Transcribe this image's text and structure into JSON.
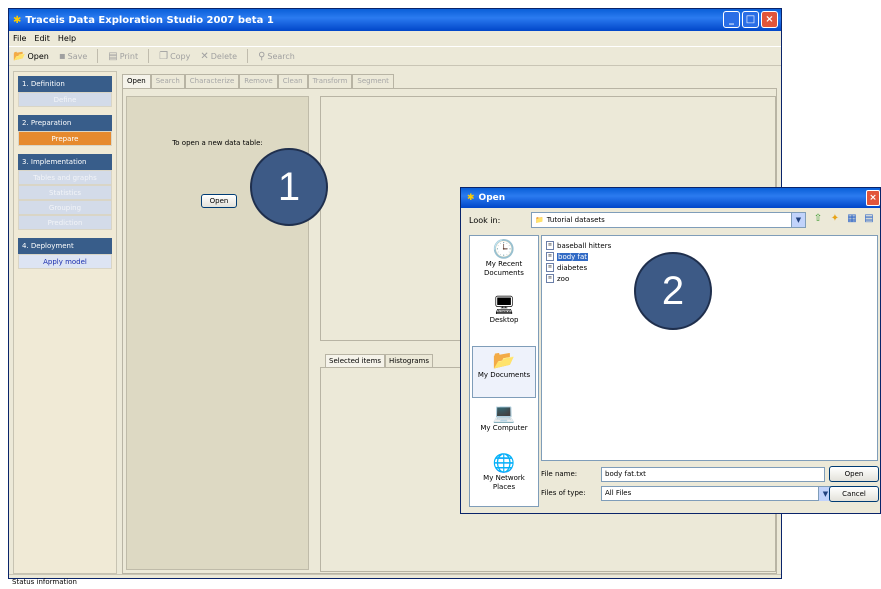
{
  "window": {
    "title": "Traceis Data Exploration Studio 2007 beta 1"
  },
  "menu": [
    "File",
    "Edit",
    "Help"
  ],
  "toolbar": {
    "open": "Open",
    "save": "Save",
    "print": "Print",
    "copy": "Copy",
    "delete": "Delete",
    "search": "Search"
  },
  "sidebar": {
    "s1": {
      "head": "1. Definition",
      "items": [
        "Define"
      ]
    },
    "s2": {
      "head": "2. Preparation",
      "items": [
        "Prepare"
      ]
    },
    "s3": {
      "head": "3. Implementation",
      "items": [
        "Tables and graphs",
        "Statistics",
        "Grouping",
        "Prediction"
      ]
    },
    "s4": {
      "head": "4. Deployment",
      "items": [
        "Apply model"
      ]
    }
  },
  "tabs": [
    "Open",
    "Search",
    "Characterize",
    "Remove",
    "Clean",
    "Transform",
    "Segment"
  ],
  "open_panel": {
    "prompt": "To open a new data table:",
    "button": "Open"
  },
  "view_tabs": [
    "Selected items",
    "Histograms"
  ],
  "status": "Status information",
  "steps": [
    "1",
    "2"
  ],
  "dialog": {
    "title": "Open",
    "look_in_label": "Look in:",
    "look_in_value": "Tutorial datasets",
    "places": [
      "My Recent Documents",
      "Desktop",
      "My Documents",
      "My Computer",
      "My Network Places"
    ],
    "files": [
      "baseball hitters",
      "body fat",
      "diabetes",
      "zoo"
    ],
    "file_name_label": "File name:",
    "file_name_value": "body fat.txt",
    "file_type_label": "Files of type:",
    "file_type_value": "All Files",
    "open_button": "Open",
    "cancel_button": "Cancel"
  }
}
